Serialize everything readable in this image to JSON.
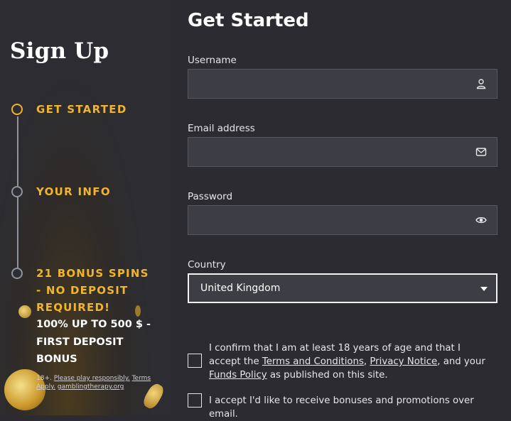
{
  "sidebar": {
    "title": "Sign Up",
    "steps": [
      {
        "label": "GET STARTED",
        "active": true
      },
      {
        "label": "YOUR INFO",
        "active": false
      },
      {
        "label": "21 BONUS SPINS - NO DEPOSIT REQUIRED!",
        "active": false
      }
    ],
    "bonus_detail": "100% UP TO 500 $ - FIRST DEPOSIT BONUS",
    "fineprint": {
      "age": "18+.",
      "play_link": "Please play responsibly.",
      "terms_link": "Terms Apply.",
      "site_link": "gamblingtherapy.org"
    }
  },
  "form": {
    "heading": "Get Started",
    "username_label": "Username",
    "username_value": "",
    "username_icon": "user-icon",
    "email_label": "Email address",
    "email_value": "",
    "email_icon": "envelope-icon",
    "password_label": "Password",
    "password_value": "",
    "password_icon": "eye-icon",
    "country_label": "Country",
    "country_value": "United Kingdom",
    "consent_1": {
      "text_1": "I confirm that I am at least 18 years of age and that I accept the",
      "terms_link": "Terms and Conditions",
      "sep_1": ",",
      "privacy_link": "Privacy Notice",
      "text_2": ", and your",
      "funds_link": "Funds Policy",
      "text_3": "as published on this site."
    },
    "consent_2": "I accept I'd like to receive bonuses and promotions over email."
  },
  "colors": {
    "accent": "#f0b52c",
    "background": "#2b2b31",
    "field": "#3d3e45"
  }
}
